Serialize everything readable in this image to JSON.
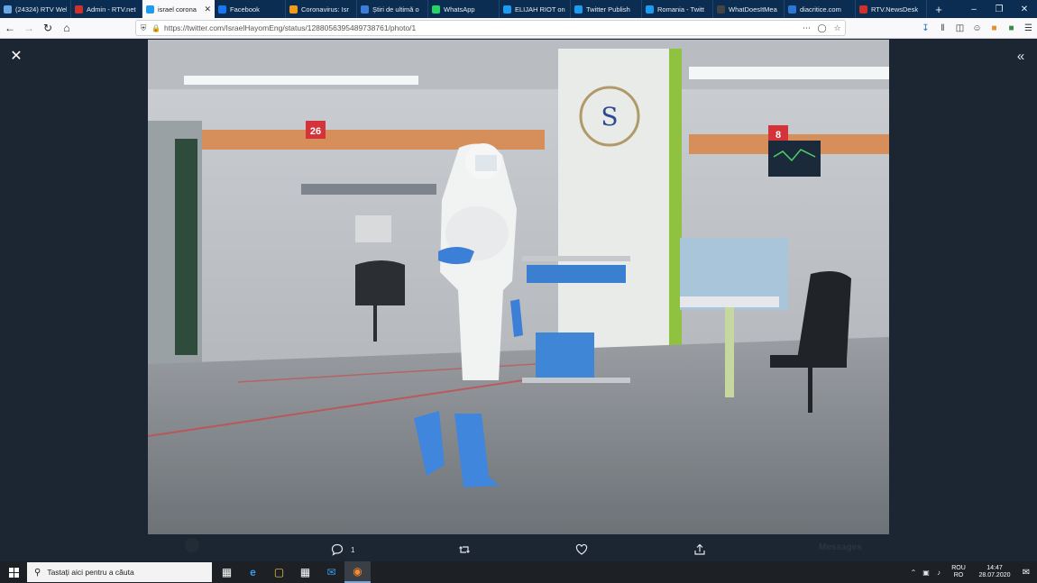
{
  "browser": {
    "tabs": [
      {
        "label": "(24324) RTV Web",
        "icon": "message-icon",
        "color": "#6aa7e0",
        "active": false
      },
      {
        "label": "Admin - RTV.net",
        "icon": "rtv-icon",
        "color": "#d0302b",
        "active": false
      },
      {
        "label": "israel corona",
        "icon": "twitter-icon",
        "color": "#1d9bf0",
        "active": true
      },
      {
        "label": "Facebook",
        "icon": "facebook-icon",
        "color": "#1877f2",
        "active": false
      },
      {
        "label": "Coronavirus: Isr",
        "icon": "flame-icon",
        "color": "#f29b1b",
        "active": false
      },
      {
        "label": "Știri de ultimă o",
        "icon": "news-icon",
        "color": "#3b7dd8",
        "active": false
      },
      {
        "label": "WhatsApp",
        "icon": "whatsapp-icon",
        "color": "#25d366",
        "active": false
      },
      {
        "label": "ELIJAH RIOT on",
        "icon": "twitter-icon",
        "color": "#1d9bf0",
        "active": false
      },
      {
        "label": "Twitter Publish",
        "icon": "twitter-icon",
        "color": "#1d9bf0",
        "active": false
      },
      {
        "label": "Romania - Twitt",
        "icon": "twitter-icon",
        "color": "#1d9bf0",
        "active": false
      },
      {
        "label": "WhatDoesItMea",
        "icon": "dictionary-icon",
        "color": "#444444",
        "active": false
      },
      {
        "label": "diacritice.com",
        "icon": "diacritice-icon",
        "color": "#2a78d4",
        "active": false
      },
      {
        "label": "RTV.NewsDesk",
        "icon": "rtv-icon",
        "color": "#d0302b",
        "active": false
      }
    ],
    "url": "https://twitter.com/IsraelHayomEng/status/1288056395489738761/photo/1"
  },
  "viewer": {
    "photo_alt": "",
    "reply_count": "1",
    "ghost_label": "Messages"
  },
  "taskbar": {
    "search_placeholder": "Tastați aici pentru a căuta",
    "lang_top": "ROU",
    "lang_bottom": "RO",
    "time": "14:47",
    "date": "28.07.2020"
  },
  "colors": {
    "tab_strip": "#0c2d52",
    "viewer_bg": "#1b2632",
    "taskbar": "#1d2025"
  }
}
